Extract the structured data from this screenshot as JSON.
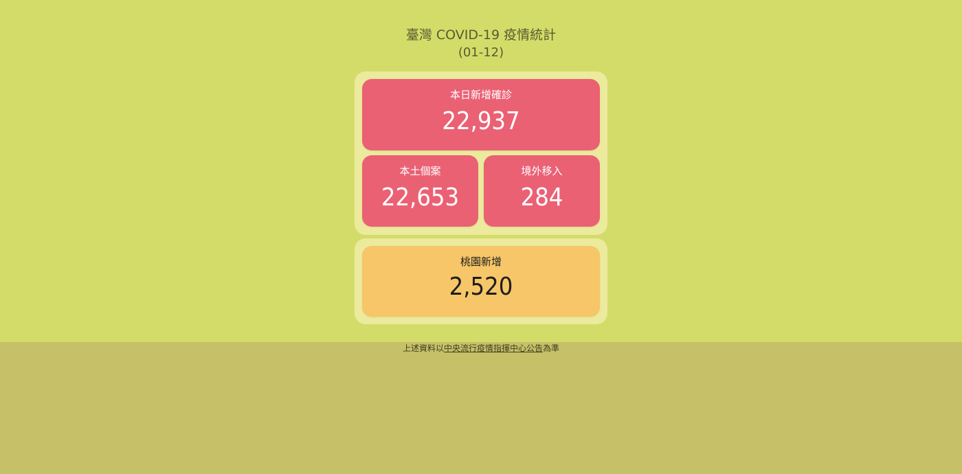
{
  "header": {
    "title": "臺灣 COVID-19 疫情統計",
    "date": "(01-12)"
  },
  "stats": {
    "total": {
      "label": "本日新增確診",
      "value": "22,937"
    },
    "local": {
      "label": "本土個案",
      "value": "22,653"
    },
    "imported": {
      "label": "境外移入",
      "value": "284"
    },
    "taoyuan": {
      "label": "桃園新增",
      "value": "2,520"
    }
  },
  "footer": {
    "prefix": "上述資料以",
    "link": "中央流行疫情指揮中心公告",
    "suffix": "為準"
  },
  "colors": {
    "background_top": "#d3dc68",
    "background_bottom": "#c6c068",
    "panel": "#ecea9c",
    "card_red": "#ea6174",
    "card_orange": "#f6c668"
  }
}
